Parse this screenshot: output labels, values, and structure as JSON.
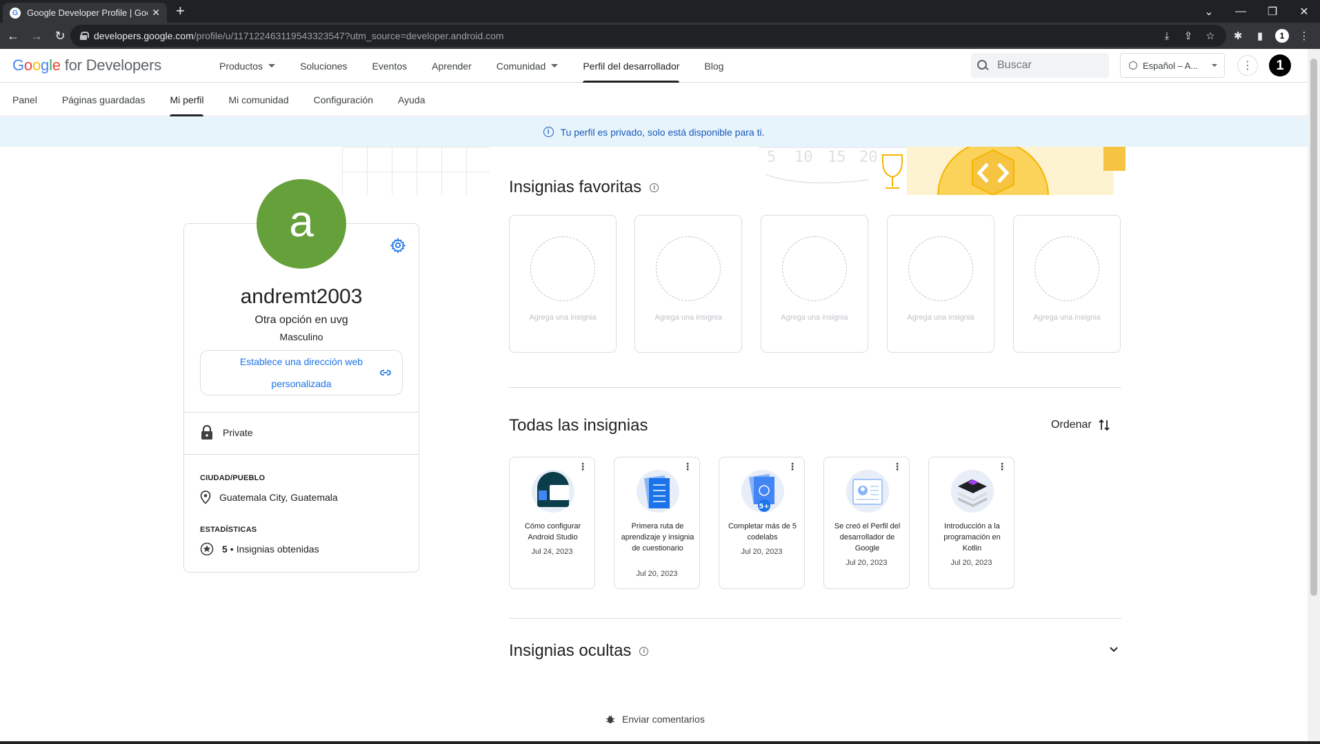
{
  "browser": {
    "tab_title": "Google Developer Profile  |  Goo",
    "url_host": "developers.google.com",
    "url_path": "/profile/u/117122463119543323547?utm_source=developer.android.com"
  },
  "header": {
    "logo_text": "for Developers",
    "nav": [
      {
        "label": "Productos"
      },
      {
        "label": "Soluciones"
      },
      {
        "label": "Eventos"
      },
      {
        "label": "Aprender"
      },
      {
        "label": "Comunidad"
      },
      {
        "label": "Perfil del desarrollador"
      },
      {
        "label": "Blog"
      }
    ],
    "search_placeholder": "Buscar",
    "language": "Español – A..."
  },
  "subnav": [
    "Panel",
    "Páginas guardadas",
    "Mi perfil",
    "Mi comunidad",
    "Configuración",
    "Ayuda"
  ],
  "banner": "Tu perfil es privado, solo está disponible para ti.",
  "profile": {
    "avatar_letter": "a",
    "username": "andremt2003",
    "affiliation": "Otra opción en uvg",
    "gender": "Masculino",
    "custom_url_label": "Establece una dirección web personalizada",
    "privacy": "Private",
    "city_label": "CIUDAD/PUEBLO",
    "city": "Guatemala City, Guatemala",
    "stats_label": "ESTADÍSTICAS",
    "badges_count": "5",
    "badges_text": "Insignias obtenidas"
  },
  "favorites": {
    "title": "Insignias favoritas",
    "slots": [
      "Agrega una insignia",
      "Agrega una insignia",
      "Agrega una insignia",
      "Agrega una insignia",
      "Agrega una insignia"
    ]
  },
  "deco_numbers": [
    "5",
    "10",
    "15",
    "20"
  ],
  "all_badges": {
    "title": "Todas las insignias",
    "sort_label": "Ordenar",
    "items": [
      {
        "name": "Cómo configurar Android Studio",
        "date": "Jul 24, 2023"
      },
      {
        "name": "Primera ruta de aprendizaje y insignia de cuestionario",
        "date": "Jul 20, 2023"
      },
      {
        "name": "Completar más de 5 codelabs",
        "date": "Jul 20, 2023",
        "badge_overlay": "5+"
      },
      {
        "name": "Se creó el Perfil del desarrollador de Google",
        "date": "Jul 20, 2023"
      },
      {
        "name": "Introducción a la programación en Kotlin",
        "date": "Jul 20, 2023"
      }
    ]
  },
  "hidden": {
    "title": "Insignias ocultas"
  },
  "feedback": "Enviar comentarios",
  "colors": {
    "avatar": "#65a03b",
    "link": "#1a73e8",
    "banner_bg": "#e8f4fb",
    "banner_text": "#185abc"
  }
}
